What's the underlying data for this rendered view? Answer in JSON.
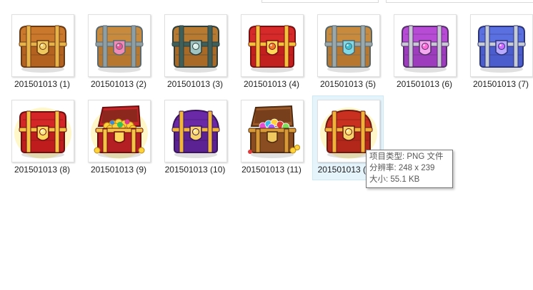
{
  "files": [
    {
      "name": "201501013 (1)",
      "icon": "wooden-chest-icon"
    },
    {
      "name": "201501013 (2)",
      "icon": "pink-heart-chest-icon"
    },
    {
      "name": "201501013 (3)",
      "icon": "dark-teal-chest-icon"
    },
    {
      "name": "201501013 (4)",
      "icon": "red-gold-chest-icon"
    },
    {
      "name": "201501013 (5)",
      "icon": "cyan-silver-chest-icon"
    },
    {
      "name": "201501013 (6)",
      "icon": "purple-winged-chest-icon"
    },
    {
      "name": "201501013 (7)",
      "icon": "blue-silver-chest-icon"
    },
    {
      "name": "201501013 (8)",
      "icon": "red-lucky-chest-icon"
    },
    {
      "name": "201501013 (9)",
      "icon": "open-gold-coin-chest-icon"
    },
    {
      "name": "201501013 (10)",
      "icon": "purple-gold-chest-icon"
    },
    {
      "name": "201501013 (11)",
      "icon": "open-gem-chest-icon"
    },
    {
      "name": "201501013 (12)",
      "icon": "red-gold-round-chest-icon"
    }
  ],
  "tooltip": {
    "type_line": "项目类型: PNG 文件",
    "dims_line": "分辨率: 248 x 239",
    "size_line": "大小: 55.1 KB"
  },
  "colors": {
    "hover_bg": "#e5f3fb",
    "tooltip_border": "#767676"
  }
}
